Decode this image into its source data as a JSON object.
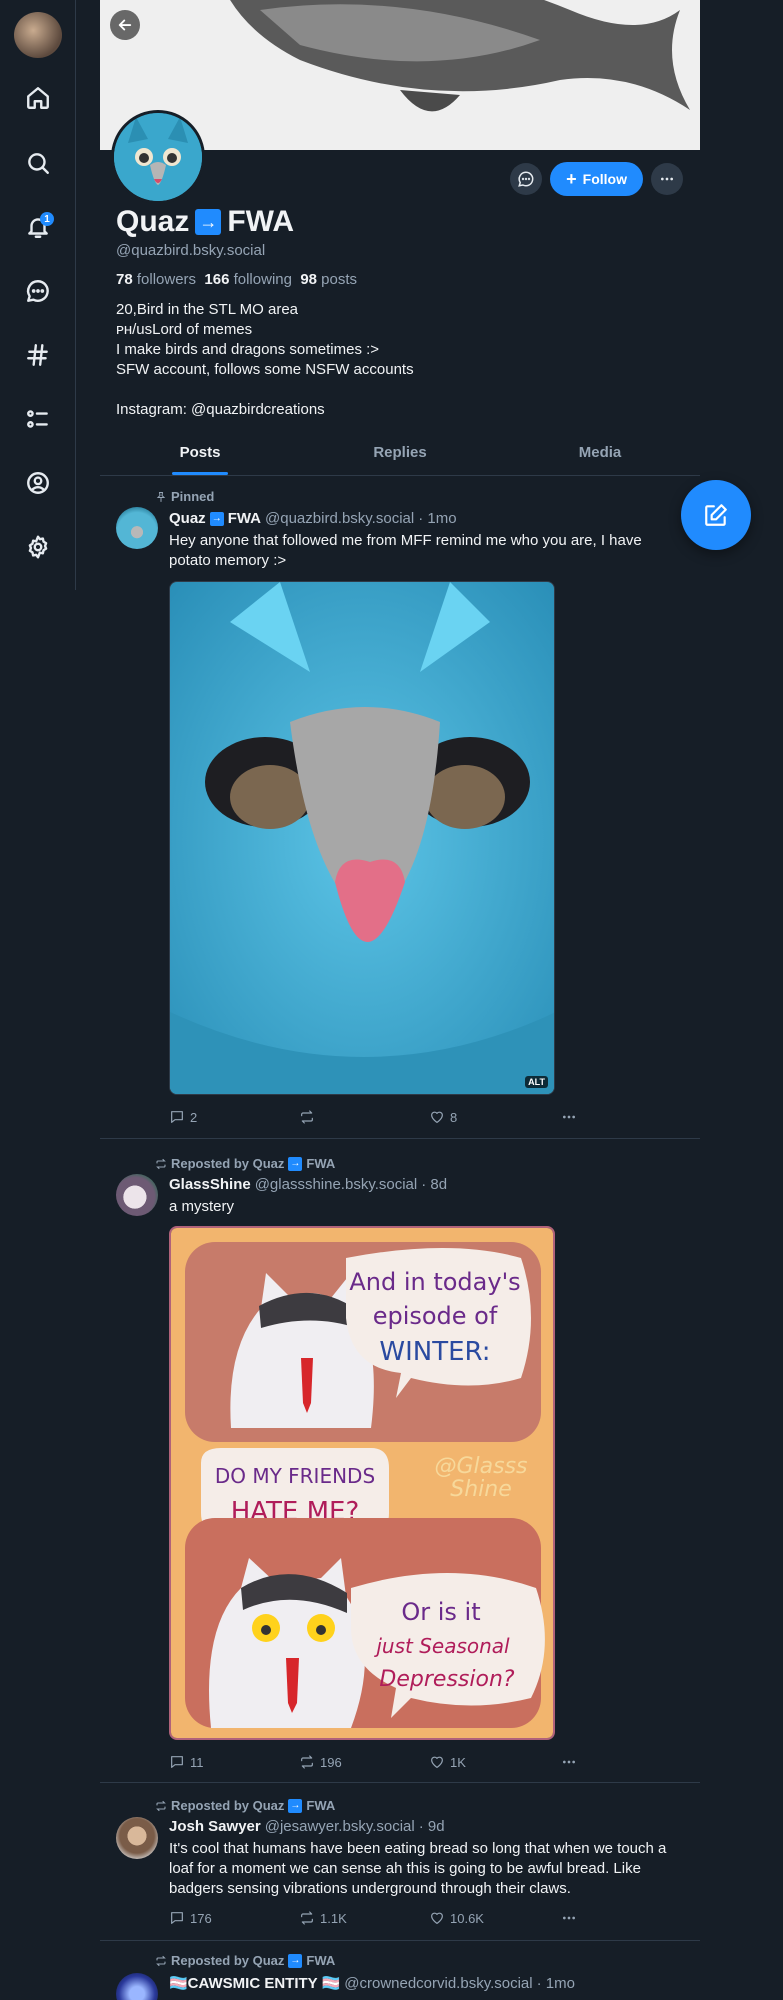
{
  "profile": {
    "display_name": "Quaz",
    "display_name_tail": "FWA",
    "handle": "@quazbird.bsky.social",
    "followers_count": "78",
    "followers_label": "followers",
    "following_count": "166",
    "following_label": "following",
    "posts_count": "98",
    "posts_label": "posts",
    "bio": [
      "20,Bird in the STL MO area",
      "ᴘʜ/usLord of memes",
      "I make birds and dragons sometimes :>",
      "SFW account, follows some NSFW accounts",
      "",
      "Instagram: @quazbirdcreations"
    ],
    "follow_label": "Follow"
  },
  "notifications_badge": "1",
  "tabs": [
    "Posts",
    "Replies",
    "Media"
  ],
  "posts": [
    {
      "reason": "Pinned",
      "author": "Quaz",
      "author_tail": "FWA",
      "handle": "@quazbird.bsky.social",
      "time": "· 1mo",
      "text": "Hey anyone that followed me from MFF remind me who you are, I have potato memory :>",
      "alt": "ALT",
      "replies": "2",
      "reposts": "",
      "likes": "8"
    },
    {
      "reason": "Reposted by Quaz",
      "reason_tail": "FWA",
      "author": "GlassShine",
      "handle": "@glassshine.bsky.social",
      "time": "· 8d",
      "text": "a mystery",
      "replies": "11",
      "reposts": "196",
      "likes": "1K",
      "comic": {
        "panel1": [
          "And in today's",
          "episode of",
          "WINTER:"
        ],
        "panel2": [
          "DO MY FRIENDS",
          "HATE ME?"
        ],
        "signature": [
          "@Glasss",
          "Shine"
        ],
        "panel3": [
          "Or is it",
          "just Seasonal",
          "Depression?"
        ]
      }
    },
    {
      "reason": "Reposted by Quaz",
      "reason_tail": "FWA",
      "author": "Josh Sawyer",
      "handle": "@jesawyer.bsky.social",
      "time": "· 9d",
      "text": "It's cool that humans have been eating bread so long that when we touch a loaf for a moment we can sense ah this is going to be awful bread. Like badgers sensing vibrations underground through their claws.",
      "replies": "176",
      "reposts": "1.1K",
      "likes": "10.6K"
    },
    {
      "reason": "Reposted by Quaz",
      "reason_tail": "FWA",
      "author": "🏳️‍⚧️CAWSMIC ENTITY 🏳️‍⚧️",
      "handle": "@crownedcorvid.bsky.social",
      "time": "· 1mo"
    }
  ],
  "colors": {
    "background": "#161e27",
    "accent": "#208bfe",
    "muted_text": "#95a4b4",
    "border": "#2e3a48"
  },
  "icons": [
    "home-icon",
    "search-icon",
    "bell-icon",
    "chat-icon",
    "hashtag-icon",
    "list-icon",
    "profile-icon",
    "gear-icon",
    "back-arrow-icon",
    "compose-icon",
    "pin-icon",
    "repost-icon",
    "reply-icon",
    "heart-icon",
    "more-icon"
  ]
}
